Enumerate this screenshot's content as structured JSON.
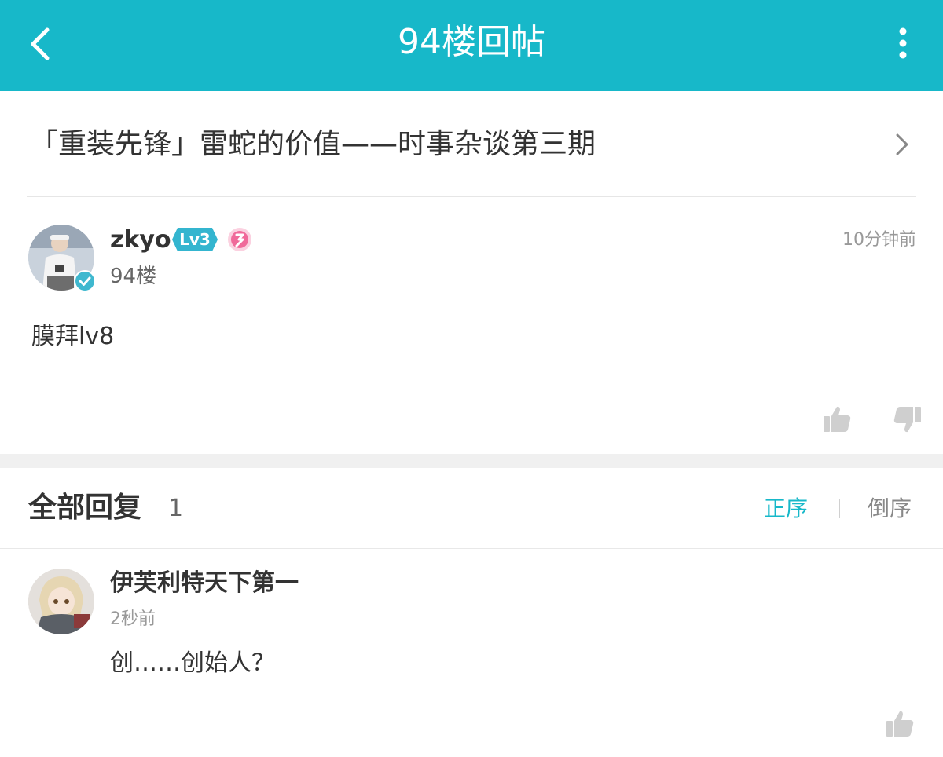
{
  "header": {
    "title": "94楼回帖",
    "back_icon": "chevron-left-icon",
    "more_icon": "more-vertical-icon",
    "bg": "#17b8c9"
  },
  "thread": {
    "title": "「重装先锋」雷蛇的价值——时事杂谈第三期"
  },
  "post": {
    "username": "zkyo",
    "level": "Lv3",
    "floor": "94楼",
    "time": "10分钟前",
    "content": "膜拜lv8"
  },
  "replies": {
    "heading": "全部回复",
    "count": "1",
    "sort_asc": "正序",
    "sort_desc": "倒序",
    "items": [
      {
        "username": "伊芙利特天下第一",
        "time": "2秒前",
        "content": "创……创始人？"
      }
    ]
  },
  "colors": {
    "accent": "#17b8c9",
    "level_badge": "#34b5cf",
    "medal": "#f06a9a"
  }
}
